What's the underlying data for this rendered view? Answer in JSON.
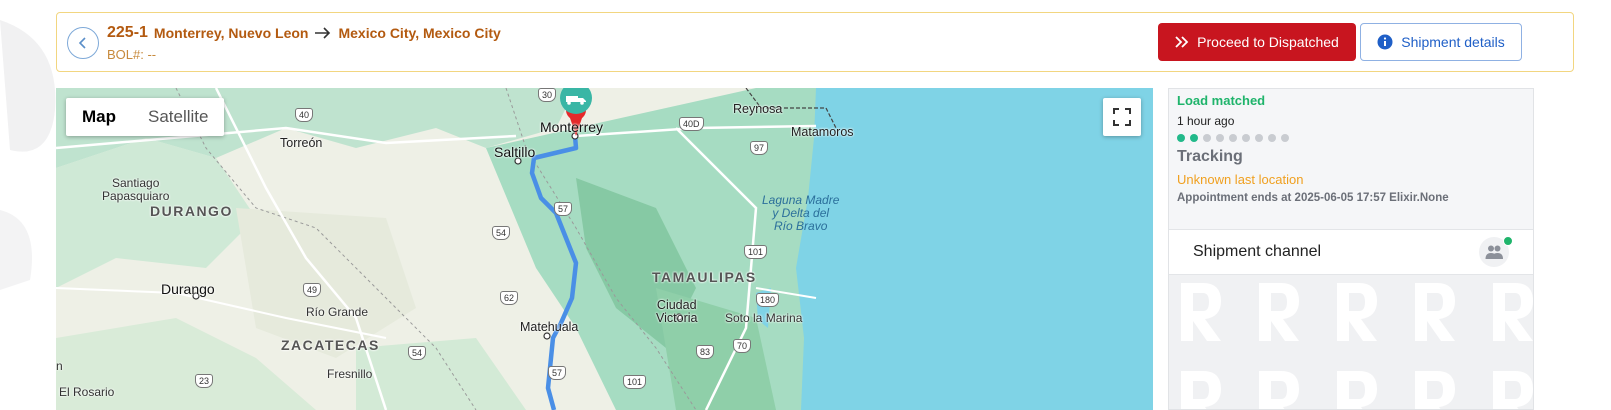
{
  "header": {
    "load_id": "225-1",
    "origin": "Monterrey, Nuevo Leon",
    "destination": "Mexico City, Mexico City",
    "bol": "BOL#: --",
    "proceed_label": "Proceed to Dispatched",
    "details_label": "Shipment details"
  },
  "map": {
    "type_options": [
      "Map",
      "Satellite"
    ],
    "selected_type": "Map",
    "labels": {
      "reynosa": "Reynosa",
      "matamoros": "Matamoros",
      "monterrey": "Monterrey",
      "saltillo": "Saltillo",
      "torreon": "Torreón",
      "santiago": "Santiago\nPapasquiaro",
      "durango_state": "DURANGO",
      "durango_city": "Durango",
      "tamaulipas": "TAMAULIPAS",
      "laguna": "Laguna Madre\ny Delta del\nRío Bravo",
      "rio_grande": "Río Grande",
      "zacatecas": "ZACATECAS",
      "matehuala": "Matehuala",
      "ciudad_victoria": "Ciudad\nVictoria",
      "soto": "Soto la Marina",
      "fresnillo": "Fresnillo",
      "el_rosario": "El Rosario",
      "edge_n": "n"
    },
    "shields": [
      "40",
      "30",
      "40D",
      "97",
      "57",
      "54",
      "101",
      "49",
      "62",
      "180",
      "54",
      "83",
      "70",
      "23",
      "57",
      "101"
    ]
  },
  "status": {
    "headline": "Load matched",
    "time": "1 hour ago",
    "progress": {
      "completed": 2,
      "total": 9
    },
    "tracking": "Tracking",
    "location": "Unknown last location",
    "appointment": "Appointment ends at 2025-06-05 17:57 Elixir.None"
  },
  "channel": {
    "title": "Shipment channel",
    "online": true
  },
  "colors": {
    "accent_red": "#c8151f",
    "link_blue": "#1f5fc7",
    "success_green": "#1fb46b",
    "warning_orange": "#f0a020",
    "route_blue": "#4a8fe6",
    "water": "#7fd3e6"
  }
}
